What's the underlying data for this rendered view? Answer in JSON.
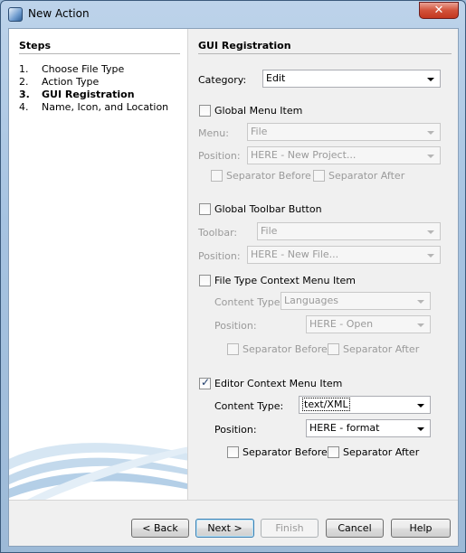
{
  "window": {
    "title": "New Action",
    "close_label": "✕"
  },
  "steps": {
    "title": "Steps",
    "items": [
      {
        "num": "1.",
        "label": "Choose File Type"
      },
      {
        "num": "2.",
        "label": "Action Type"
      },
      {
        "num": "3.",
        "label": "GUI Registration"
      },
      {
        "num": "4.",
        "label": "Name, Icon, and Location"
      }
    ],
    "current_index": 2
  },
  "gui": {
    "title": "GUI Registration",
    "category": {
      "label": "Category:",
      "value": "Edit"
    },
    "global_menu": {
      "checkbox_label": "Global Menu Item",
      "checked": false,
      "menu_label": "Menu:",
      "menu_value": "File",
      "position_label": "Position:",
      "position_value": "HERE - New Project...",
      "sep_before": "Separator Before",
      "sep_after": "Separator After"
    },
    "global_toolbar": {
      "checkbox_label": "Global Toolbar Button",
      "checked": false,
      "toolbar_label": "Toolbar:",
      "toolbar_value": "File",
      "position_label": "Position:",
      "position_value": "HERE - New File..."
    },
    "file_type_context": {
      "checkbox_label": "File Type Context Menu Item",
      "checked": false,
      "content_type_label": "Content Type:",
      "content_type_value": "Languages",
      "position_label": "Position:",
      "position_value": "HERE - Open",
      "sep_before": "Separator Before",
      "sep_after": "Separator After"
    },
    "editor_context": {
      "checkbox_label": "Editor Context Menu Item",
      "checked": true,
      "content_type_label": "Content Type:",
      "content_type_value": "text/XML",
      "position_label": "Position:",
      "position_value": "HERE - format",
      "sep_before": "Separator Before",
      "sep_after": "Separator After"
    }
  },
  "buttons": {
    "back": "< Back",
    "next": "Next >",
    "finish": "Finish",
    "cancel": "Cancel",
    "help": "Help"
  }
}
